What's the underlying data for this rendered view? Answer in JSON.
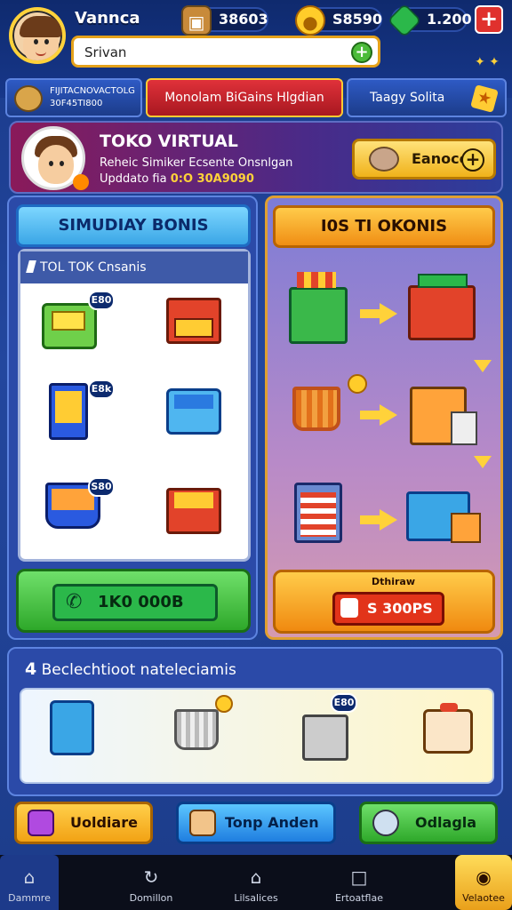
{
  "player": {
    "name": "Vannca"
  },
  "search": {
    "value": "Srivan"
  },
  "resources": [
    {
      "icon": "chest-icon",
      "value": "38603"
    },
    {
      "icon": "coin-icon",
      "value": "S8590"
    },
    {
      "icon": "gem-icon",
      "value": "1.200"
    }
  ],
  "tabs": [
    {
      "label": "FIJITACNOVACTOLG",
      "sub": "30F45TI800"
    },
    {
      "label": "Monolam BiGains Hlgdian"
    },
    {
      "label": "Taagy Solita"
    }
  ],
  "profile": {
    "title": "TOKO VIRTUAL",
    "subtitle": "Reheic Simiker Ecsente Onsnlgan",
    "update_label": "Upddato fia",
    "update_value": "0:O 30A9090",
    "button_label": "Eanoco"
  },
  "left_panel": {
    "header": "SIMUDIAY BONIS",
    "grid_title": "TOL TOK Cnsanis",
    "prices": [
      "E80",
      "E8k",
      "S80"
    ],
    "button_label": "1K0 000B"
  },
  "right_panel": {
    "header": "I0S TI OKONIS",
    "button_top": "Dthiraw",
    "button_label": "S 300PS"
  },
  "bottom_panel": {
    "title_prefix": "4",
    "title": "Beclechtioot nateleciamis",
    "price": "E80"
  },
  "actions": [
    {
      "label": "Uoldiare",
      "color": "#f2a214"
    },
    {
      "label": "Tonp Anden",
      "color": "#1f7ee0"
    },
    {
      "label": "Odlagla",
      "color": "#2ea82a"
    }
  ],
  "nav": [
    {
      "icon": "home-icon",
      "label": "Dammre"
    },
    {
      "icon": "refresh-icon",
      "label": "Domillon"
    },
    {
      "icon": "house-icon",
      "label": "Lilsalices"
    },
    {
      "icon": "square-icon",
      "label": "Ertoatflae"
    },
    {
      "icon": "badge-icon",
      "label": "Velaotee"
    }
  ]
}
